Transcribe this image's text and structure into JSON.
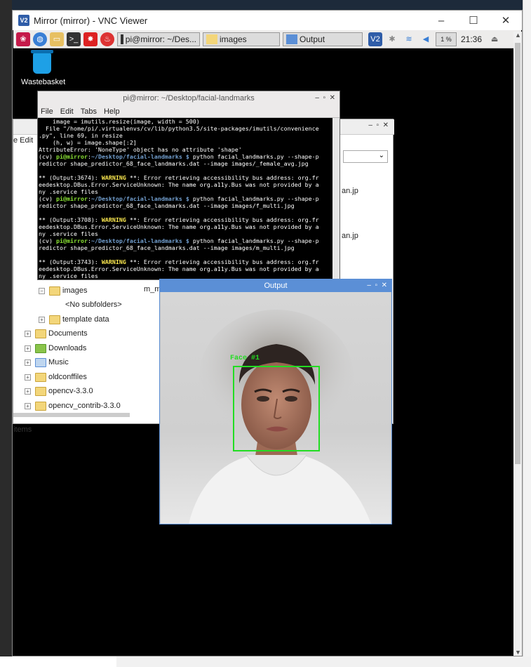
{
  "vnc_window": {
    "title": "Mirror (mirror) - VNC Viewer",
    "logo_text": "V2"
  },
  "taskbar": {
    "tasks": [
      {
        "label": "pi@mirror: ~/Des..."
      },
      {
        "label": "images"
      },
      {
        "label": "Output"
      }
    ],
    "cpu_label": "1 %",
    "clock": "21:36"
  },
  "desktop": {
    "wastebasket_label": "Wastebasket"
  },
  "file_manager": {
    "tree_items": [
      {
        "label": "images"
      },
      {
        "label": "<No subfolders>"
      },
      {
        "label": "template data"
      },
      {
        "label": "Documents"
      },
      {
        "label": "Downloads"
      },
      {
        "label": "Music"
      },
      {
        "label": "oldconffiles"
      },
      {
        "label": "opencv-3.3.0"
      },
      {
        "label": "opencv_contrib-3.3.0"
      }
    ],
    "status_text": "items",
    "file_labels": [
      "an.jp",
      "an.jp",
      "m_m"
    ],
    "menu_partial": "e  Edit"
  },
  "terminal": {
    "title": "pi@mirror: ~/Desktop/facial-landmarks",
    "menu": [
      "File",
      "Edit",
      "Tabs",
      "Help"
    ]
  },
  "output_window": {
    "title": "Output",
    "face_label": "Face #1"
  },
  "colors": {
    "vnc_logo": "#2f5da8",
    "output_titlebar": "#5b8fd6",
    "face_box": "#22dd22"
  }
}
